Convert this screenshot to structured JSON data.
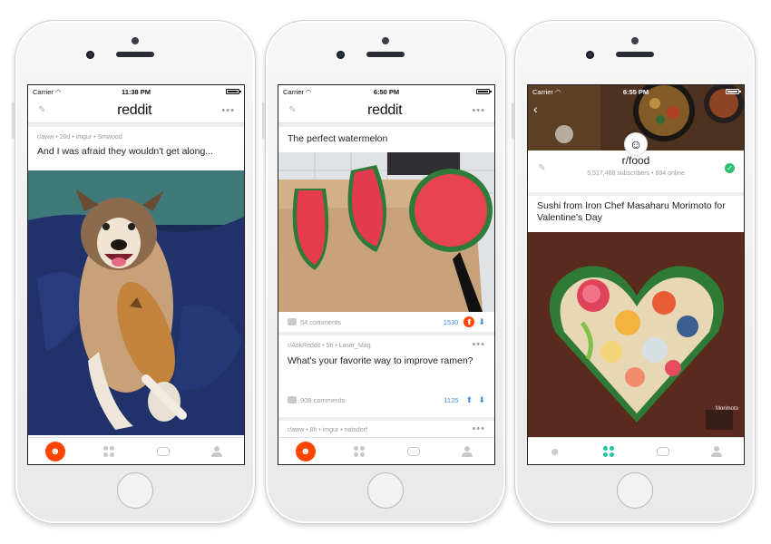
{
  "colors": {
    "accent": "#ff4500",
    "link": "#3a8fd8",
    "online": "#2fbf71",
    "tab_active": "#1ec3a0"
  },
  "phones": [
    {
      "status": {
        "carrier": "Carrier",
        "time": "11:38 PM"
      },
      "logo": "reddit",
      "post": {
        "meta": "r/aww • 20d • imgur • Smwood",
        "title": "And I was afraid they wouldn't get along..."
      }
    },
    {
      "status": {
        "carrier": "Carrier",
        "time": "6:50 PM"
      },
      "logo": "reddit",
      "post1": {
        "title": "The perfect watermelon",
        "comments": "54 comments",
        "score": "1530"
      },
      "post2": {
        "meta": "r/AskReddit • 5h • Laser_Mag",
        "title": "What's your favorite way to improve ramen?",
        "comments": "908 comments",
        "score": "1125"
      },
      "post3": {
        "meta": "r/aww • 8h • imgur • natsdorf"
      }
    },
    {
      "status": {
        "carrier": "Carrier",
        "time": "6:55 PM"
      },
      "subreddit": {
        "name": "r/food",
        "stats": "5,517,468 subscribers • 884 online"
      },
      "post": {
        "title": "Sushi from Iron Chef Masaharu Morimoto for Valentine's Day",
        "watermark": "Morimoto"
      }
    }
  ],
  "icons": {
    "pencil": "pencil-icon",
    "more": "more-dots-icon",
    "comment": "comment-icon",
    "upvote": "upvote-icon",
    "downvote": "downvote-icon",
    "tab_home": "reddit-home-icon",
    "tab_explore": "explore-grid-icon",
    "tab_inbox": "inbox-chat-icon",
    "tab_profile": "profile-icon"
  }
}
